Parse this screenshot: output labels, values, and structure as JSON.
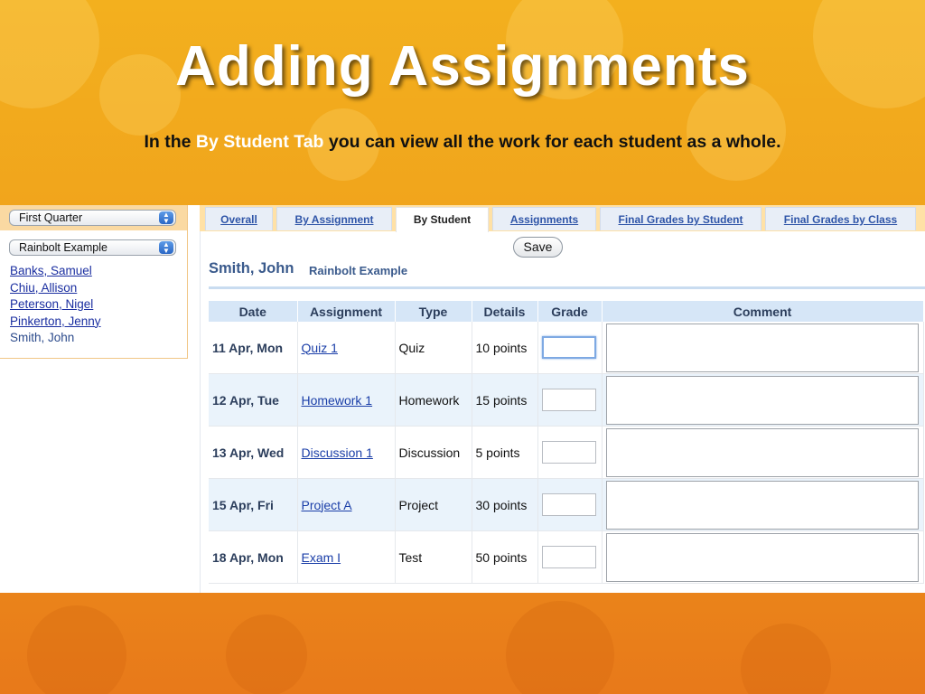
{
  "slide": {
    "title": "Adding Assignments",
    "subtitle_prefix": "In the ",
    "subtitle_highlight": "By Student Tab",
    "subtitle_suffix": " you can view all the work for each student as a whole."
  },
  "sidebar": {
    "quarter_select": "First Quarter",
    "class_select": "Rainbolt Example",
    "students": [
      "Banks, Samuel",
      "Chiu, Allison",
      "Peterson, Nigel",
      "Pinkerton, Jenny"
    ],
    "current_student": "Smith, John"
  },
  "tabs": [
    {
      "label": "Overall",
      "active": false
    },
    {
      "label": "By Assignment",
      "active": false
    },
    {
      "label": "By Student",
      "active": true
    },
    {
      "label": "Assignments",
      "active": false
    },
    {
      "label": "Final Grades by Student",
      "active": false
    },
    {
      "label": "Final Grades by Class",
      "active": false
    }
  ],
  "main": {
    "save_label": "Save",
    "student_name": "Smith, John",
    "class_name": "Rainbolt Example",
    "columns": [
      "Date",
      "Assignment",
      "Type",
      "Details",
      "Grade",
      "Comment"
    ],
    "rows": [
      {
        "date": "11 Apr, Mon",
        "assignment": "Quiz 1",
        "type": "Quiz",
        "details": "10 points",
        "grade": "",
        "comment": ""
      },
      {
        "date": "12 Apr, Tue",
        "assignment": "Homework 1",
        "type": "Homework",
        "details": "15 points",
        "grade": "",
        "comment": ""
      },
      {
        "date": "13 Apr, Wed",
        "assignment": "Discussion 1",
        "type": "Discussion",
        "details": "5 points",
        "grade": "",
        "comment": ""
      },
      {
        "date": "15 Apr, Fri",
        "assignment": "Project A",
        "type": "Project",
        "details": "30 points",
        "grade": "",
        "comment": ""
      },
      {
        "date": "18 Apr, Mon",
        "assignment": "Exam I",
        "type": "Test",
        "details": "50 points",
        "grade": "",
        "comment": ""
      }
    ]
  },
  "colors": {
    "background_top": "#f3b01e",
    "background_bottom": "#e8791a",
    "link": "#1a3ea8",
    "header_fill": "#d6e6f7",
    "alt_row_fill": "#eaf3fb"
  }
}
